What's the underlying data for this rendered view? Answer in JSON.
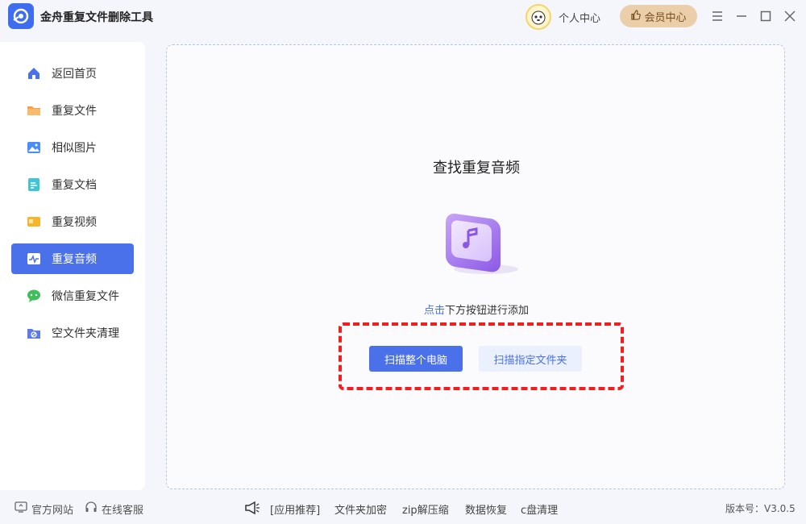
{
  "app": {
    "title": "金舟重复文件删除工具"
  },
  "header": {
    "personal_center": "个人中心",
    "vip_center": "会员中心"
  },
  "sidebar": {
    "items": [
      {
        "label": "返回首页",
        "icon": "home-icon",
        "color": "#4b71ea"
      },
      {
        "label": "重复文件",
        "icon": "folder-icon",
        "color": "#f5a04a"
      },
      {
        "label": "相似图片",
        "icon": "image-icon",
        "color": "#4b8df8"
      },
      {
        "label": "重复文档",
        "icon": "document-icon",
        "color": "#3ec6d6"
      },
      {
        "label": "重复视频",
        "icon": "video-icon",
        "color": "#f8b52a"
      },
      {
        "label": "重复音频",
        "icon": "audio-icon",
        "color": "#ffffff",
        "active": true
      },
      {
        "label": "微信重复文件",
        "icon": "wechat-icon",
        "color": "#3fbf5a"
      },
      {
        "label": "空文件夹清理",
        "icon": "empty-folder-icon",
        "color": "#5b7be8"
      }
    ]
  },
  "main": {
    "title": "查找重复音频",
    "hint_link": "点击",
    "hint_rest": "下方按钮进行添加",
    "scan_pc_label": "扫描整个电脑",
    "scan_folder_label": "扫描指定文件夹"
  },
  "footer": {
    "official_site": "官方网站",
    "online_service": "在线客服",
    "links": [
      "[应用推荐]",
      "文件夹加密",
      "zip解压缩",
      "数据恢复",
      "c盘清理"
    ],
    "version": "版本号：V3.0.5"
  },
  "colors": {
    "accent": "#4b71ea",
    "highlight": "#f21e1e",
    "vip": "#ebcfaa"
  }
}
